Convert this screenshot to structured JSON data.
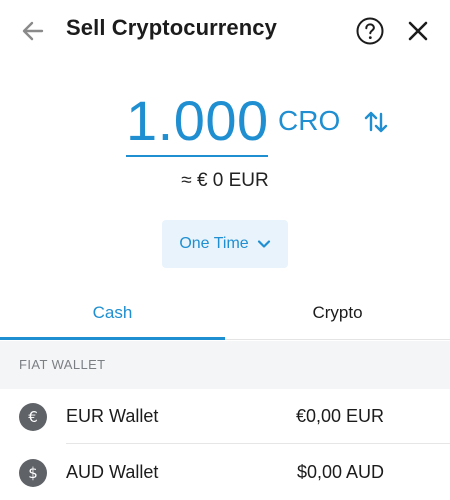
{
  "header": {
    "title": "Sell Cryptocurrency",
    "icons": {
      "back": "arrow-left-icon",
      "help": "question-circle-icon",
      "close": "close-icon"
    }
  },
  "amount": {
    "value": "1.000",
    "currency": "CRO",
    "fiat_estimate": "≈ € 0 EUR",
    "swap_icon": "swap-vertical-icon"
  },
  "frequency": {
    "label": "One Time",
    "icon": "chevron-down-icon"
  },
  "tabs": [
    {
      "label": "Cash",
      "active": true
    },
    {
      "label": "Crypto",
      "active": false
    }
  ],
  "section": {
    "title": "FIAT WALLET"
  },
  "wallets": [
    {
      "symbol": "€",
      "name": "EUR Wallet",
      "balance": "€0,00 EUR",
      "icon": "euro-icon"
    },
    {
      "symbol": "$",
      "name": "AUD Wallet",
      "balance": "$0,00 AUD",
      "icon": "dollar-icon"
    }
  ],
  "colors": {
    "accent": "#1f8fd1",
    "accent_bg": "#e8f3fb",
    "section_bg": "#f4f5f6",
    "icon_bg": "#5f6368"
  }
}
